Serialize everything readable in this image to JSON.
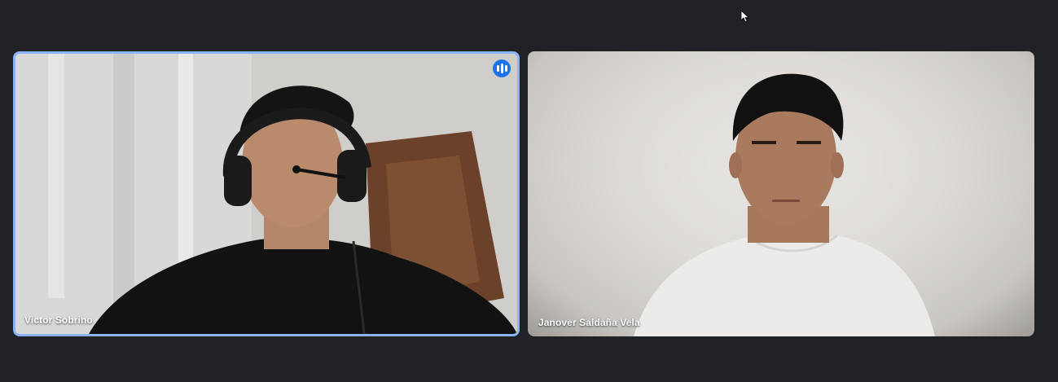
{
  "meeting": {
    "participants": [
      {
        "name": "Victor Sobrino",
        "is_speaking": true
      },
      {
        "name": "Janover Saldaña Vela",
        "is_speaking": false
      }
    ]
  },
  "colors": {
    "background": "#202124",
    "active_speaker_border": "#8ab4f8",
    "speaking_badge": "#1a73e8"
  },
  "icons": {
    "speaking": "audio-level-icon",
    "cursor": "mouse-pointer-icon"
  }
}
